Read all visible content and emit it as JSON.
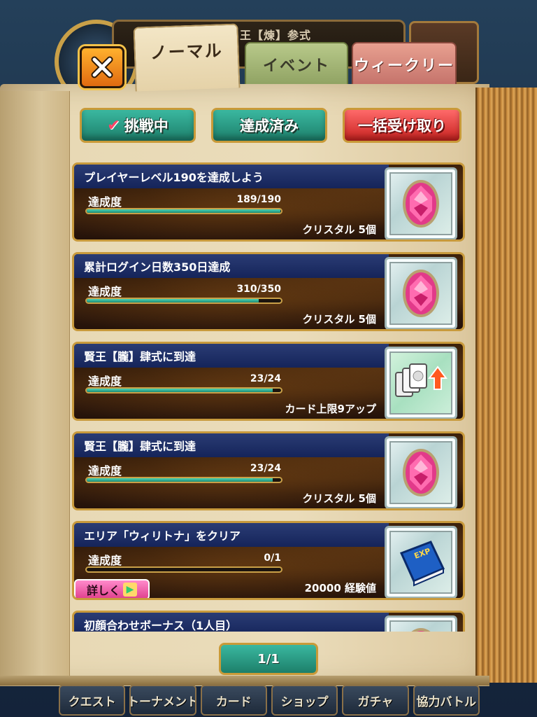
{
  "header": {
    "title_partial": "王【煉】参式"
  },
  "tabs": [
    {
      "label": "ノーマル",
      "active": true
    },
    {
      "label": "イベント",
      "active": false
    },
    {
      "label": "ウィークリー",
      "active": false
    }
  ],
  "filters": {
    "challenge_label": "挑戦中",
    "achieved_label": "達成済み",
    "receive_all_label": "一括受け取り"
  },
  "missions": [
    {
      "title": "プレイヤーレベル190を達成しよう",
      "progress_label": "達成度",
      "progress_text": "189/190",
      "progress": 0.995,
      "reward": "クリスタル 5個",
      "reward_icon": "crystal-icon"
    },
    {
      "title": "累計ログイン日数350日達成",
      "progress_label": "達成度",
      "progress_text": "310/350",
      "progress": 0.886,
      "reward": "クリスタル 5個",
      "reward_icon": "crystal-icon"
    },
    {
      "title": "賢王【朧】肆式に到達",
      "progress_label": "達成度",
      "progress_text": "23/24",
      "progress": 0.958,
      "reward": "カード上限9アップ",
      "reward_icon": "card-limit-up-icon"
    },
    {
      "title": "賢王【朧】肆式に到達",
      "progress_label": "達成度",
      "progress_text": "23/24",
      "progress": 0.958,
      "reward": "クリスタル 5個",
      "reward_icon": "crystal-icon"
    },
    {
      "title": "エリア「ウィリトナ」をクリア",
      "progress_label": "達成度",
      "progress_text": "0/1",
      "progress": 0.0,
      "reward": "20000 経験値",
      "reward_icon": "exp-book-icon",
      "detail_label": "詳しく"
    },
    {
      "title": "初顔合わせボーナス（1人目）",
      "reward_icon": "crystal-icon"
    }
  ],
  "pagination": {
    "label": "1/1"
  },
  "bottom_nav": [
    {
      "label": "クエスト"
    },
    {
      "label": "トーナメント"
    },
    {
      "label": "カード"
    },
    {
      "label": "ショップ"
    },
    {
      "label": "ガチャ"
    },
    {
      "label": "協力バトル"
    }
  ],
  "colors": {
    "accent_teal": "#1d7f6a",
    "accent_red": "#c8221f",
    "title_bar_blue": "#15245a",
    "frame_gold": "#c89a3c"
  }
}
